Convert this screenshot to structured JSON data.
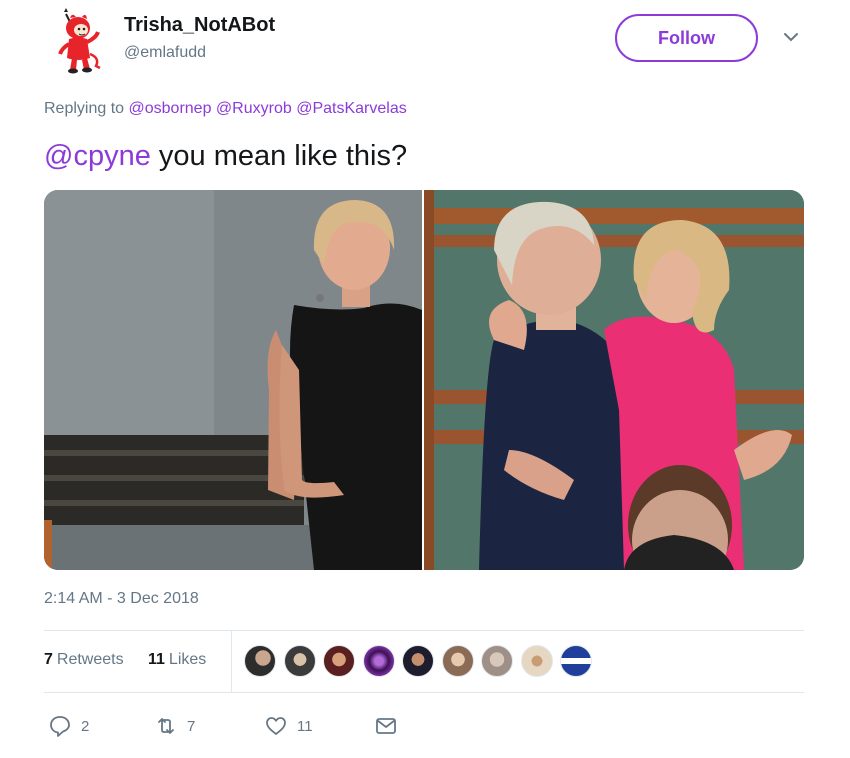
{
  "user": {
    "display_name": "Trisha_NotABot",
    "handle": "@emlafudd",
    "avatar_icon": "red-devil-cartoon-avatar"
  },
  "follow_button": {
    "label": "Follow"
  },
  "caret_icon": "chevron-down-icon",
  "reply": {
    "prefix": "Replying to",
    "mentions": [
      "@osbornep",
      "@Ruxyrob",
      "@PatsKarvelas"
    ]
  },
  "tweet": {
    "mention": "@cpyne",
    "text": " you mean like this?"
  },
  "media": {
    "left_photo": "woman in black dress",
    "right_photo": "two women hugging in parliament"
  },
  "timestamp": "2:14 AM - 3 Dec 2018",
  "stats": {
    "retweets_count": "7",
    "retweets_label": "Retweets",
    "likes_count": "11",
    "likes_label": "Likes"
  },
  "actions": {
    "reply_count": "2",
    "retweet_count": "7",
    "like_count": "11"
  },
  "colors": {
    "accent": "#8c3bd9",
    "secondary_text": "#657786",
    "divider": "#e1e8ed"
  }
}
